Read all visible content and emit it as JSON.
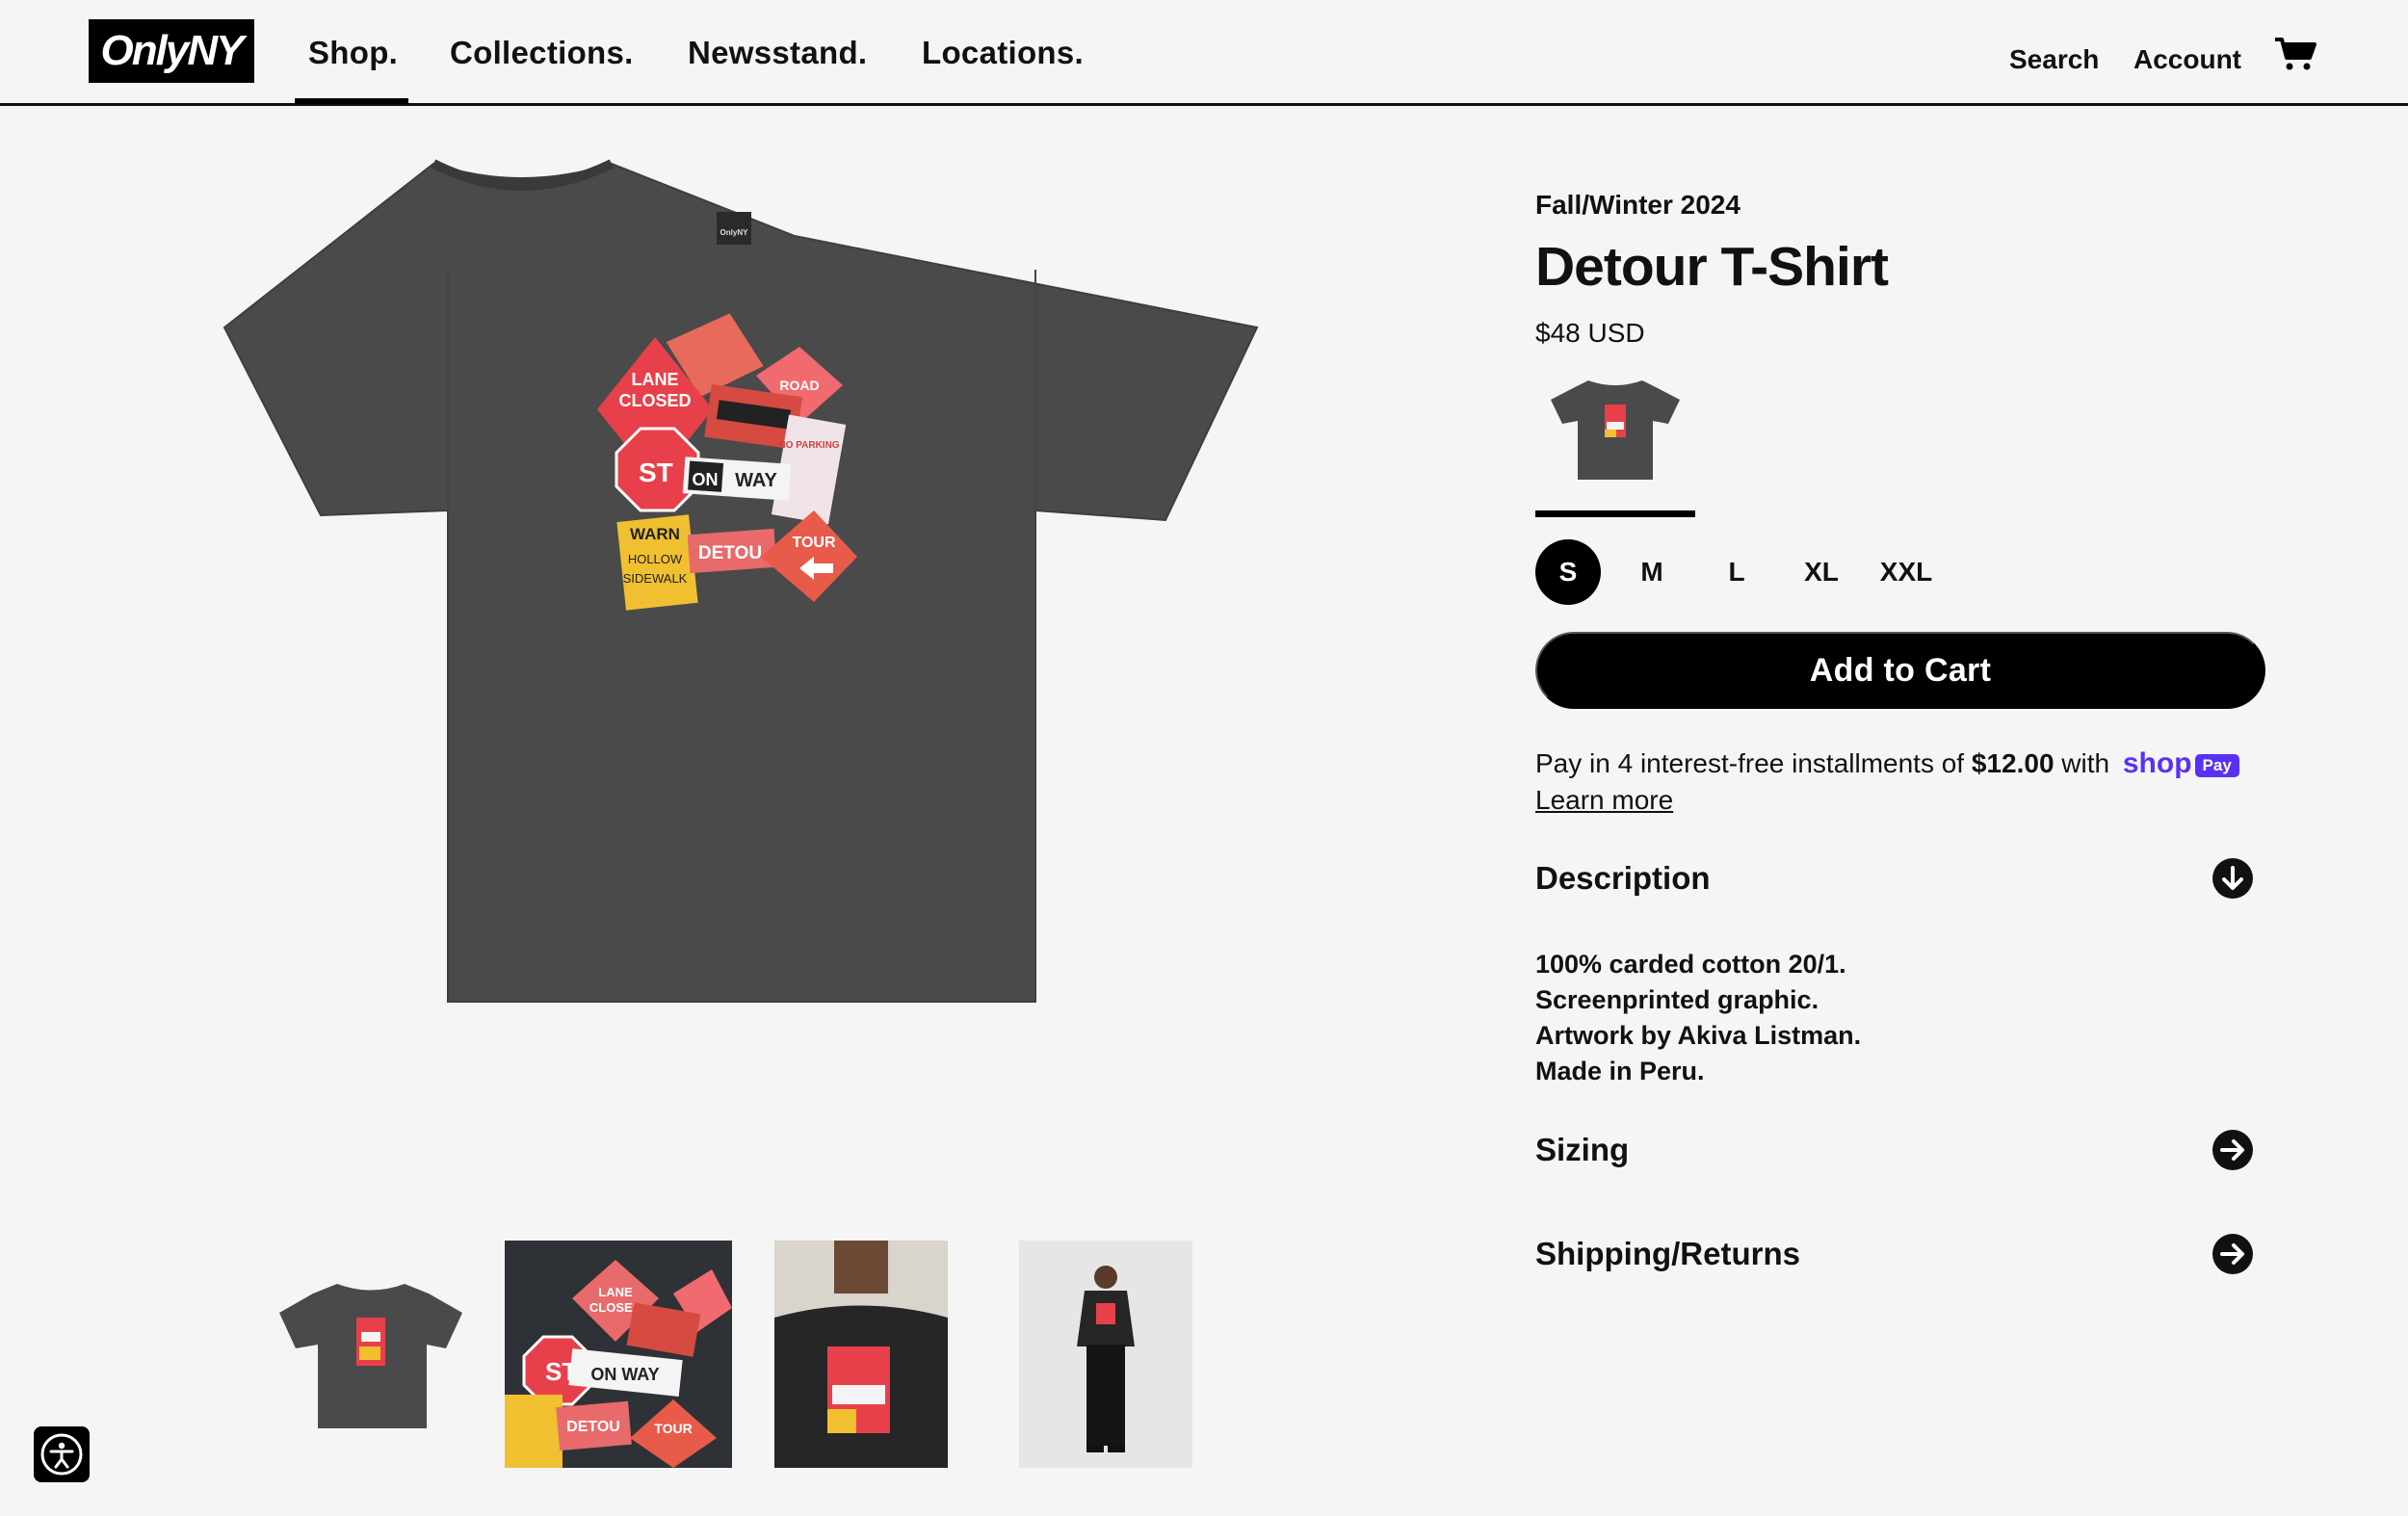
{
  "header": {
    "logo": "OnlyNY",
    "nav": [
      "Shop.",
      "Collections.",
      "Newsstand.",
      "Locations."
    ],
    "active_nav": "Shop.",
    "search": "Search",
    "account": "Account",
    "cart_icon": "cart-icon"
  },
  "product": {
    "season": "Fall/Winter 2024",
    "title": "Detour T-Shirt",
    "price": "$48 USD",
    "color_swatch": "charcoal",
    "sizes": [
      "S",
      "M",
      "L",
      "XL",
      "XXL"
    ],
    "selected_size": "S",
    "add_to_cart": "Add to Cart",
    "installments": {
      "prefix": "Pay in 4 interest-free installments of ",
      "amount": "$12.00",
      "suffix": " with ",
      "brand": "shop",
      "badge": "Pay",
      "learn_more": "Learn more"
    },
    "accordions": [
      {
        "title": "Description",
        "icon": "arrow-down-circle-icon",
        "open": true
      },
      {
        "title": "Sizing",
        "icon": "arrow-right-circle-icon",
        "open": false
      },
      {
        "title": "Shipping/Returns",
        "icon": "arrow-right-circle-icon",
        "open": false
      }
    ],
    "description": [
      "100% carded cotton 20/1.",
      "Screenprinted graphic.",
      "Artwork by Akiva Listman.",
      "Made in Peru."
    ]
  },
  "graphic_signs": {
    "lane_closed": "LANE CLOSED",
    "road_work": "ROAD WORK AHEAD",
    "stop": "ST",
    "one_way": "ONE WAY",
    "warning": "WARNING",
    "detour": "DETOUR",
    "tour": "TOUR",
    "parking": "NO PARKING ANY TIME",
    "tag": "OnlyNY"
  },
  "colors": {
    "shirt": "#4a4a4a",
    "shirt_shadow": "#3e3e3e",
    "accent_shop": "#5a31f4",
    "sign_red": "#e8404a",
    "sign_yellow": "#f0c030"
  },
  "accessibility": {
    "icon": "accessibility-icon"
  }
}
